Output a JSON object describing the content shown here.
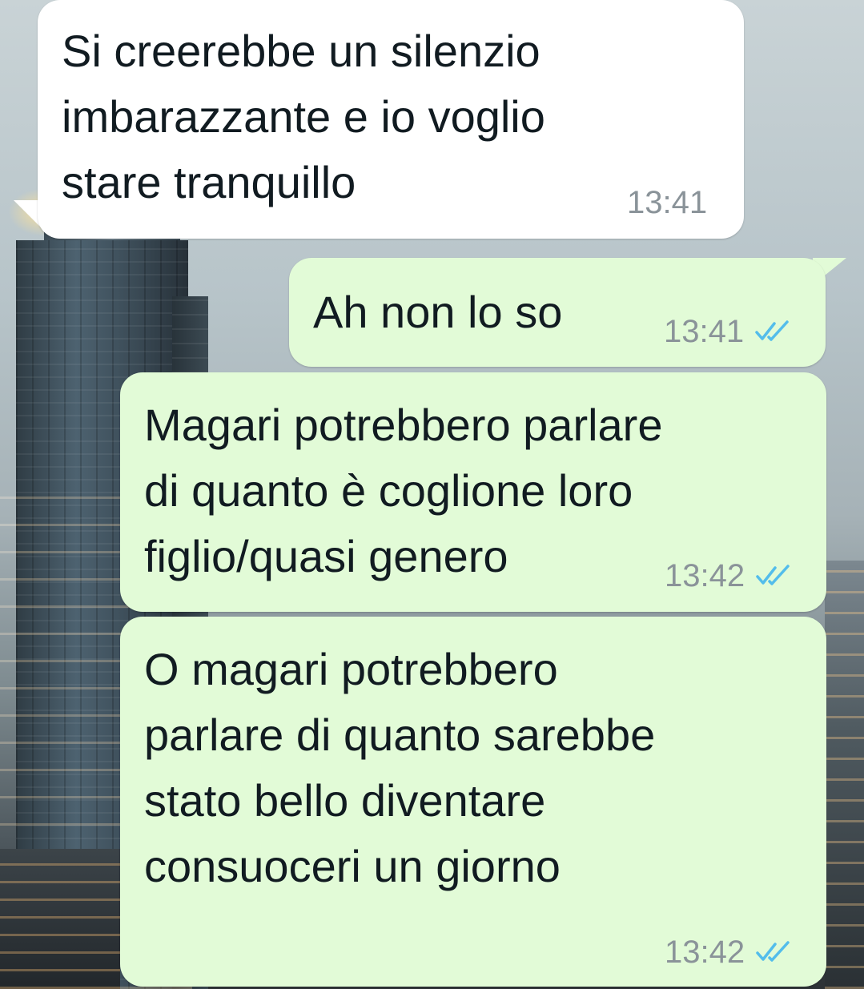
{
  "messages": [
    {
      "direction": "incoming",
      "text": "Si creerebbe un silenzio\nimbarazzante e io voglio\nstare tranquillo",
      "time": "13:41"
    },
    {
      "direction": "outgoing",
      "text": "Ah non lo so",
      "time": "13:41",
      "status": "read"
    },
    {
      "direction": "outgoing",
      "text": "Magari potrebbero parlare\ndi quanto è coglione loro\nfiglio/quasi genero",
      "time": "13:42",
      "status": "read"
    },
    {
      "direction": "outgoing",
      "text": "O magari potrebbero\nparlare di quanto sarebbe\nstato bello diventare\nconsuoceri un giorno",
      "time": "13:42",
      "status": "read"
    }
  ],
  "colors": {
    "incoming_bubble": "#ffffff",
    "outgoing_bubble": "#e2fbd7",
    "read_ticks": "#53bdeb",
    "time_text": "#8a9399"
  },
  "icons": {
    "read_receipt": "double-check-icon"
  }
}
